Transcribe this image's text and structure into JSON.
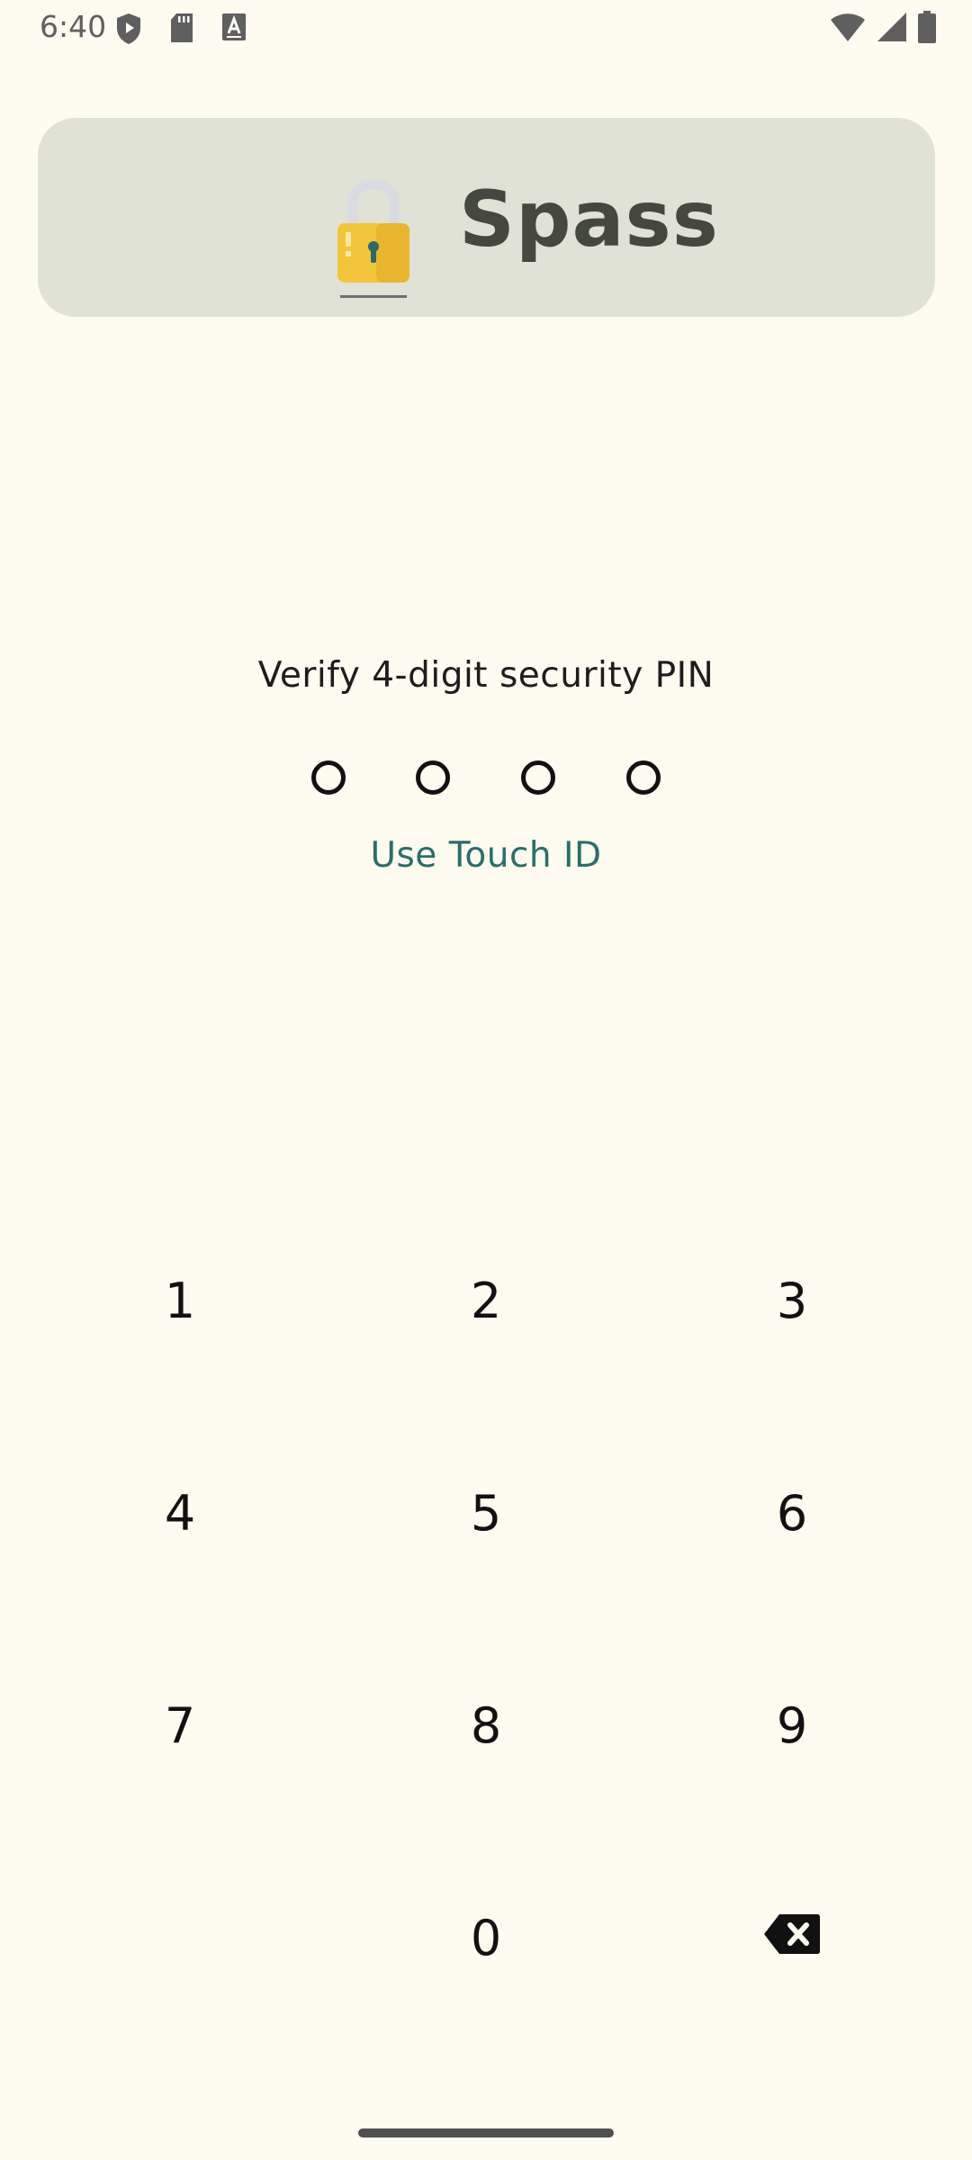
{
  "status_bar": {
    "time": "6:40",
    "left_icons": [
      "shield-play-icon",
      "sd-card-icon",
      "text-box-icon"
    ],
    "right_icons": [
      "wifi-icon",
      "cellular-signal-icon",
      "battery-icon"
    ]
  },
  "header": {
    "app_name": "Spass",
    "icon": "padlock-icon"
  },
  "pin": {
    "prompt": "Verify 4-digit security PIN",
    "digits_entered": 0,
    "digits_total": 4,
    "touch_id_label": "Use Touch ID"
  },
  "keypad": {
    "keys": [
      "1",
      "2",
      "3",
      "4",
      "5",
      "6",
      "7",
      "8",
      "9",
      "0"
    ],
    "backspace_icon": "backspace-icon"
  },
  "colors": {
    "background": "#fefbf1",
    "header_card": "#e0e2d5",
    "accent": "#2b6e68",
    "lock_body": "#f2c53d"
  }
}
